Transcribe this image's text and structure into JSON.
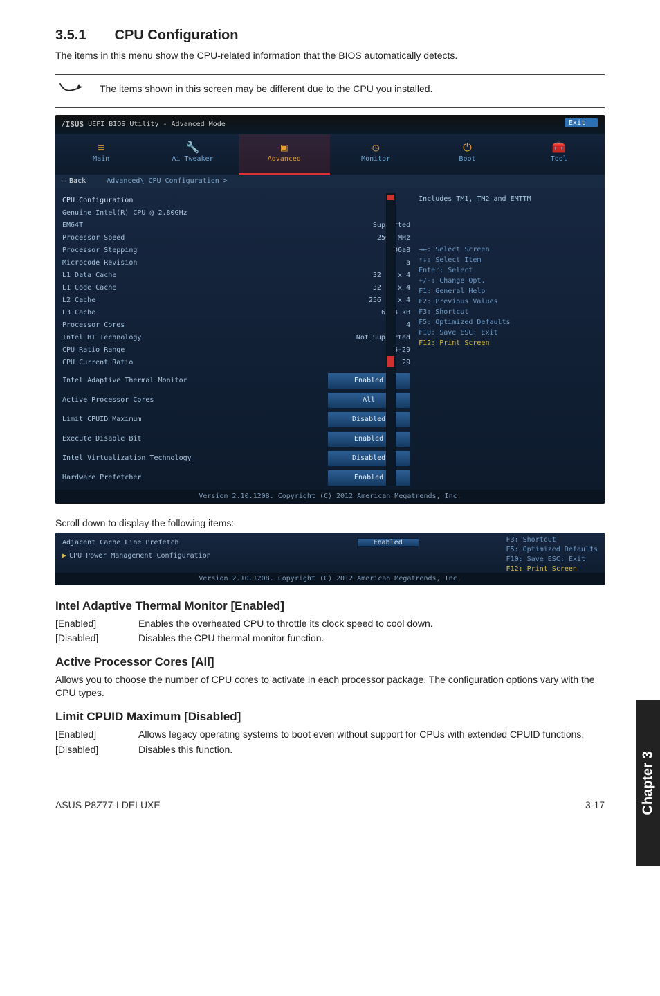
{
  "section": {
    "number": "3.5.1",
    "title": "CPU Configuration"
  },
  "intro": "The items in this menu show the CPU-related information that the BIOS automatically detects.",
  "note": "The items shown in this screen may be different due to the CPU you installed.",
  "bios": {
    "logo": "/ISUS",
    "title": "UEFI BIOS Utility - Advanced Mode",
    "exit_pill": "Exit",
    "tabs": [
      "Main",
      "Ai Tweaker",
      "Advanced",
      "Monitor",
      "Boot",
      "Tool"
    ],
    "active_tab_index": 2,
    "breadcrumb_back": "← Back",
    "breadcrumb": "Advanced\\ CPU Configuration >",
    "heading": "CPU Configuration",
    "right_note": "Includes TM1, TM2 and EMTTM",
    "info": [
      {
        "label": "Genuine Intel(R) CPU @ 2.80GHz",
        "value": ""
      },
      {
        "label": "EM64T",
        "value": "Supported"
      },
      {
        "label": "Processor Speed",
        "value": "2500 MHz"
      },
      {
        "label": "Processor Stepping",
        "value": "306a8"
      },
      {
        "label": "Microcode Revision",
        "value": "a"
      },
      {
        "label": "L1 Data Cache",
        "value": "32 kB x 4"
      },
      {
        "label": "L1 Code Cache",
        "value": "32 kB x 4"
      },
      {
        "label": "L2 Cache",
        "value": "256 kB x 4"
      },
      {
        "label": "L3 Cache",
        "value": "6144 kB"
      },
      {
        "label": "Processor Cores",
        "value": "4"
      },
      {
        "label": "Intel HT Technology",
        "value": "Not Supported"
      },
      {
        "label": "CPU Ratio Range",
        "value": "16-29"
      },
      {
        "label": "CPU Current Ratio",
        "value": "29"
      }
    ],
    "options": [
      {
        "label": "Intel Adaptive Thermal Monitor",
        "value": "Enabled"
      },
      {
        "label": "Active Processor Cores",
        "value": "All"
      },
      {
        "label": "Limit CPUID Maximum",
        "value": "Disabled"
      },
      {
        "label": "Execute Disable Bit",
        "value": "Enabled"
      },
      {
        "label": "Intel Virtualization Technology",
        "value": "Disabled"
      },
      {
        "label": "Hardware Prefetcher",
        "value": "Enabled"
      }
    ],
    "hints": [
      "→←: Select Screen",
      "↑↓: Select Item",
      "Enter: Select",
      "+/-: Change Opt.",
      "F1: General Help",
      "F2: Previous Values",
      "F3: Shortcut",
      "F5: Optimized Defaults",
      "F10: Save  ESC: Exit",
      "F12: Print Screen"
    ],
    "footer": "Version 2.10.1208. Copyright (C) 2012 American Megatrends, Inc."
  },
  "scroll_caption": "Scroll down to display the following items:",
  "bios2": {
    "opt": {
      "label": "Adjacent Cache Line Prefetch",
      "value": "Enabled"
    },
    "sub": "CPU Power Management Configuration",
    "hints": [
      "F3: Shortcut",
      "F5: Optimized Defaults",
      "F10: Save  ESC: Exit",
      "F12: Print Screen"
    ],
    "footer": "Version 2.10.1208. Copyright (C) 2012 American Megatrends, Inc."
  },
  "h_iatm": "Intel Adaptive Thermal Monitor [Enabled]",
  "iatm_en_tag": "[Enabled]",
  "iatm_en_desc": "Enables the overheated CPU to throttle its clock speed to cool down.",
  "iatm_dis_tag": "[Disabled]",
  "iatm_dis_desc": "Disables the CPU thermal monitor function.",
  "h_apc": "Active Processor Cores [All]",
  "apc_para": "Allows you to choose the number of CPU cores to activate in each processor package. The configuration options vary with the CPU types.",
  "h_lcm": "Limit CPUID Maximum [Disabled]",
  "lcm_en_tag": "[Enabled]",
  "lcm_en_desc": "Allows legacy operating systems to boot even without support for CPUs with extended CPUID functions.",
  "lcm_dis_tag": "[Disabled]",
  "lcm_dis_desc": "Disables this function.",
  "side_tab": "Chapter 3",
  "footer_left": "ASUS P8Z77-I DELUXE",
  "footer_right": "3-17"
}
